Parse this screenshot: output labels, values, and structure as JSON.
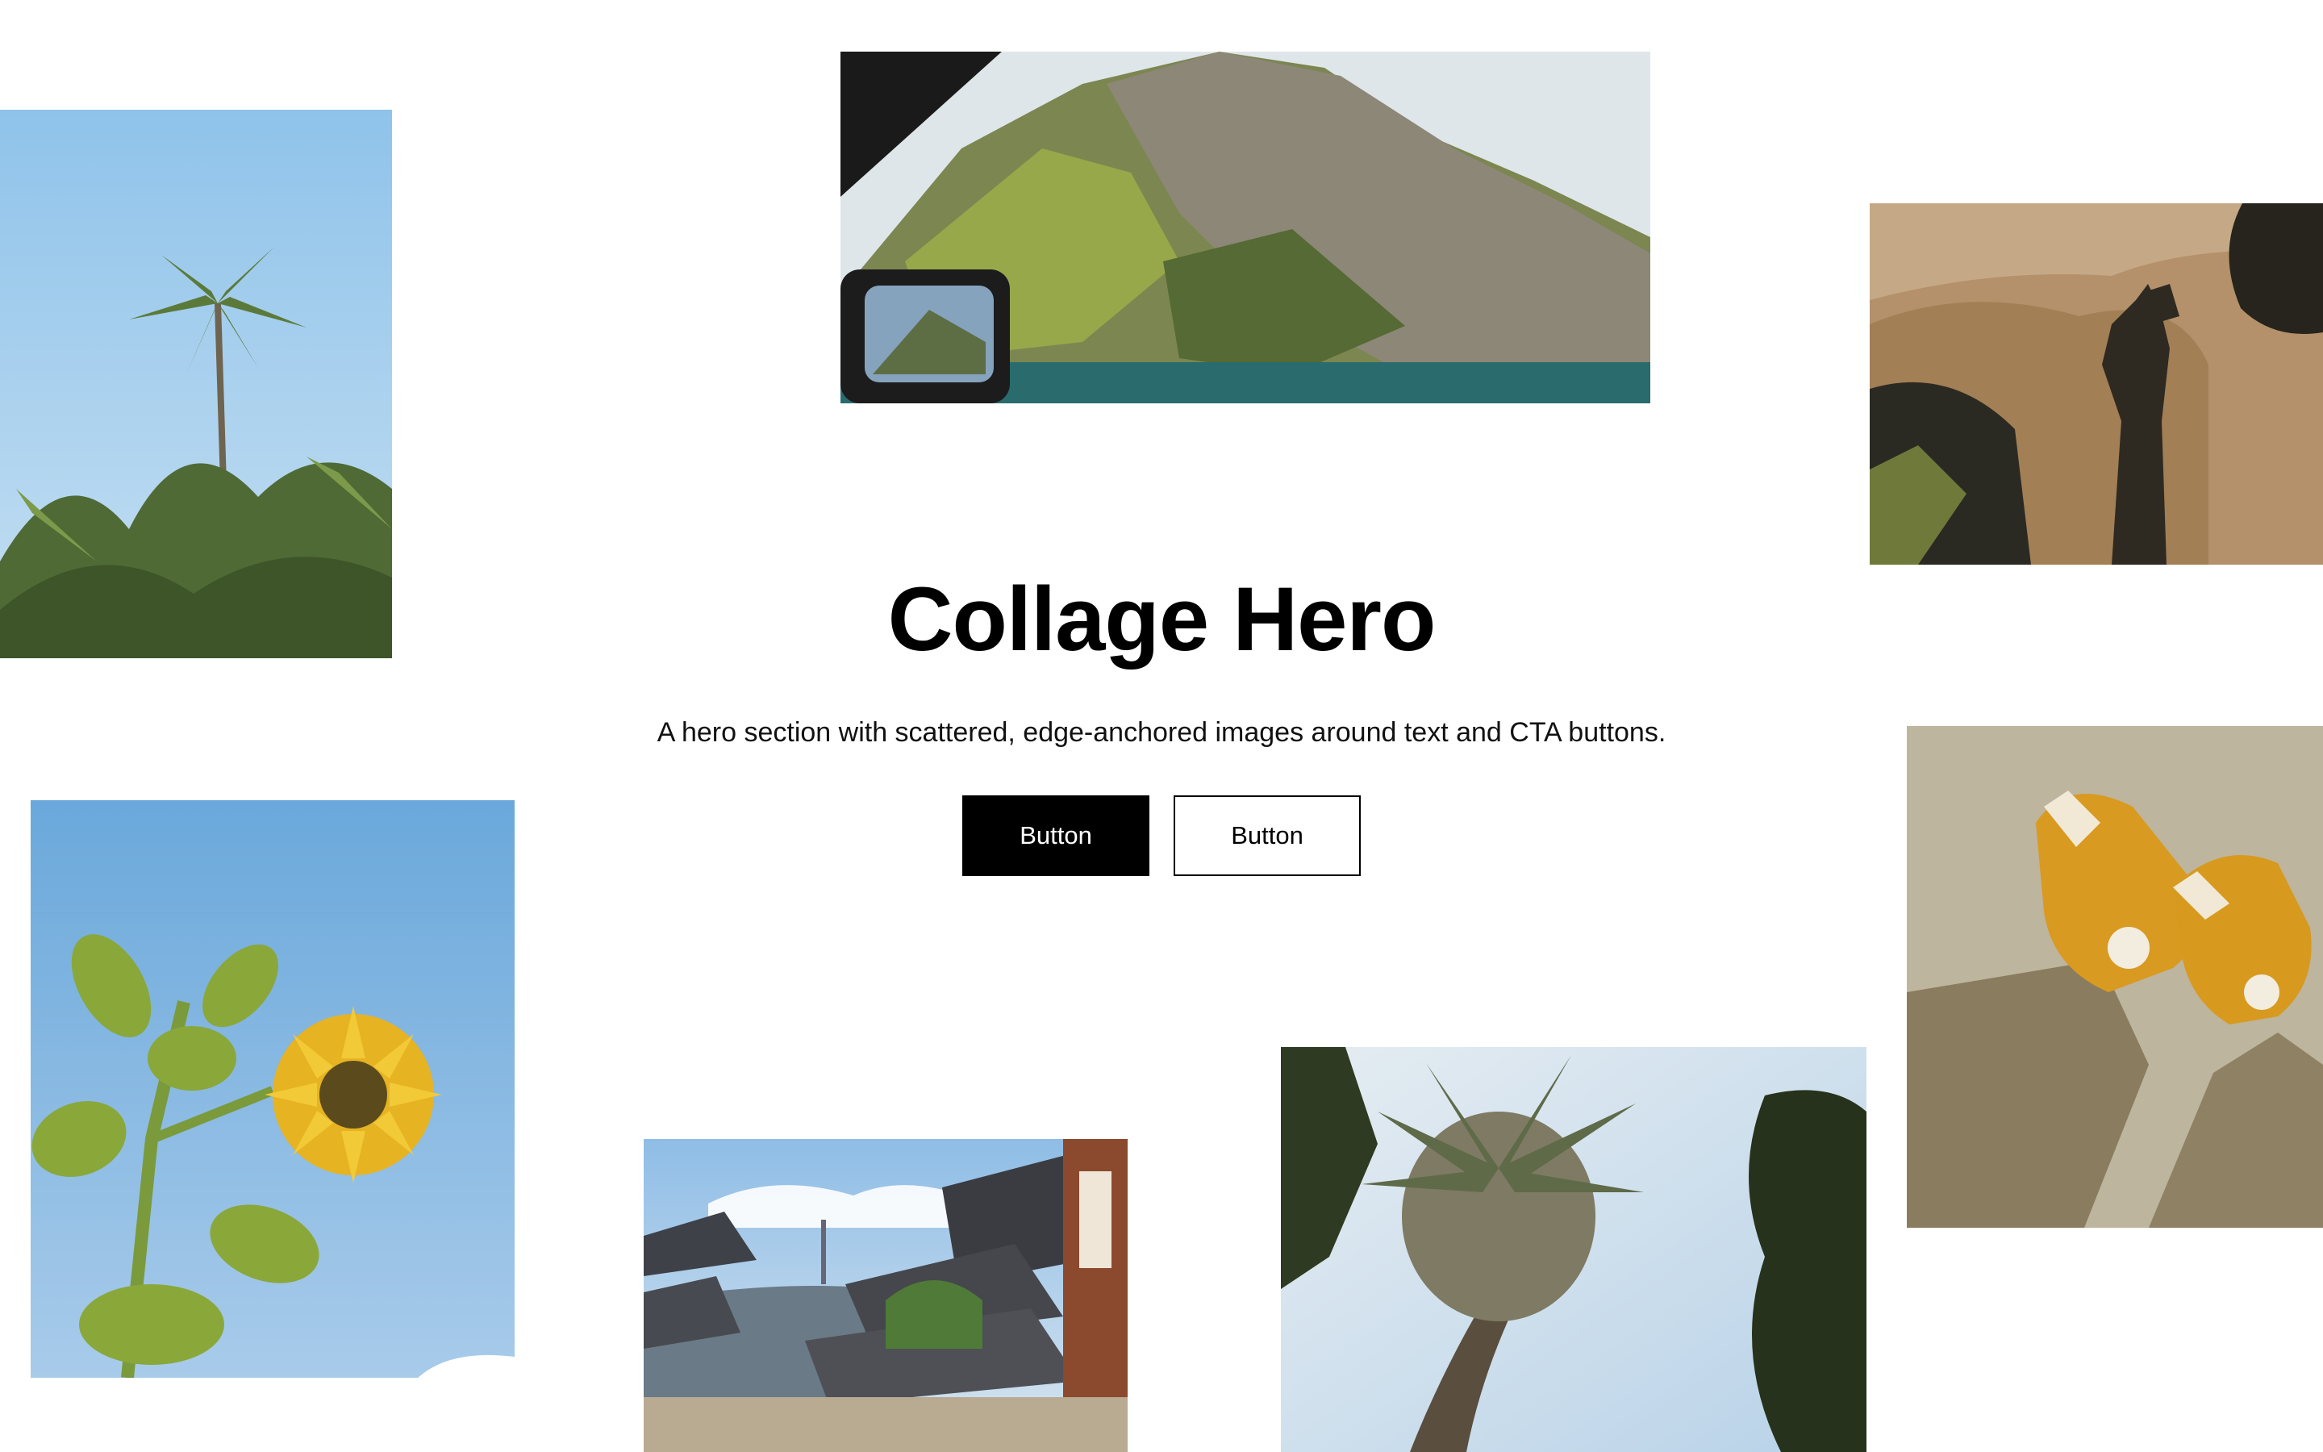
{
  "hero": {
    "title": "Collage Hero",
    "subtitle": "A hero section with scattered, edge-anchored images around text and CTA buttons.",
    "primary_button_label": "Button",
    "secondary_button_label": "Button"
  },
  "colors": {
    "background": "#ffffff",
    "text": "#000000",
    "primary_button_bg": "#000000",
    "primary_button_text": "#ffffff",
    "secondary_button_bg": "#ffffff",
    "secondary_button_border": "#000000"
  },
  "images": [
    {
      "name": "palm-trees-sky-image"
    },
    {
      "name": "mountain-lake-car-window-image"
    },
    {
      "name": "person-shadow-ground-image"
    },
    {
      "name": "sunflower-sky-image"
    },
    {
      "name": "yellow-sneakers-image"
    },
    {
      "name": "traditional-village-roofs-image"
    },
    {
      "name": "fan-palm-sky-image"
    }
  ]
}
